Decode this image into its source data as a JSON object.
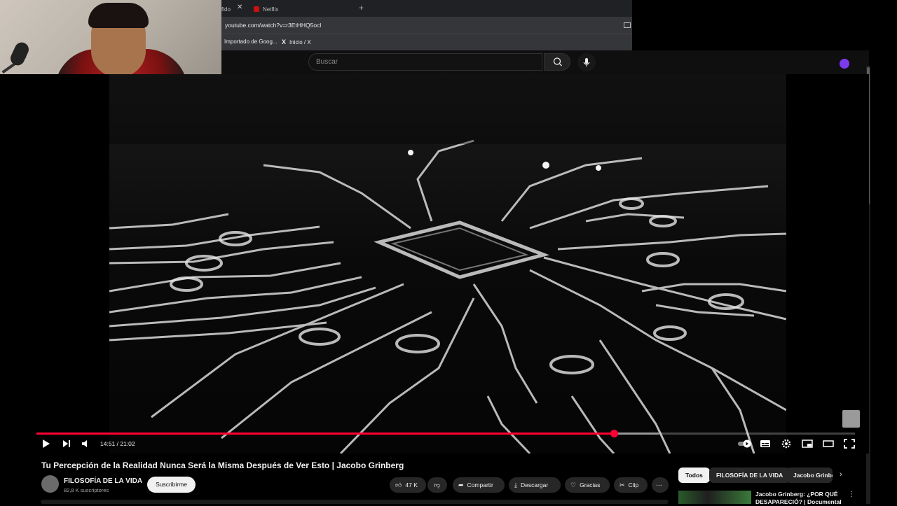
{
  "browser": {
    "tabs": [
      {
        "label": "fido"
      },
      {
        "label": "Netflix"
      }
    ],
    "url": "youtube.com/watch?v=r3EtHHQ5ocl",
    "bookmarks": [
      {
        "label": "Importado de Goog..."
      },
      {
        "label": "Inicio / X"
      }
    ]
  },
  "header": {
    "search_placeholder": "Buscar"
  },
  "player": {
    "time": "14:51 / 21:02",
    "progress_fraction": 0.7061,
    "buffer_fraction": 0.76,
    "accent_color": "#ff0033"
  },
  "video": {
    "title": "Tu Percepción de la Realidad Nunca Será la Misma Después de Ver Esto | Jacobo Grinberg",
    "channel_name": "FILOSOFÍA DE LA VIDA",
    "subscribers": "82,8 K suscriptores",
    "subscribe_label": "Suscribirme",
    "likes": "47 K",
    "share_label": "Compartir",
    "download_label": "Descargar",
    "thanks_label": "Gracias",
    "clip_label": "Clip"
  },
  "sidebar": {
    "chips": [
      {
        "label": "Todos",
        "active": true
      },
      {
        "label": "FILOSOFÍA DE LA VIDA",
        "active": false
      },
      {
        "label": "Jacobo Grinbe",
        "active": false
      }
    ],
    "recommendation": {
      "title": "Jacobo Grinberg: ¿POR QUÉ DESAPARECIÓ? | Documental"
    }
  }
}
